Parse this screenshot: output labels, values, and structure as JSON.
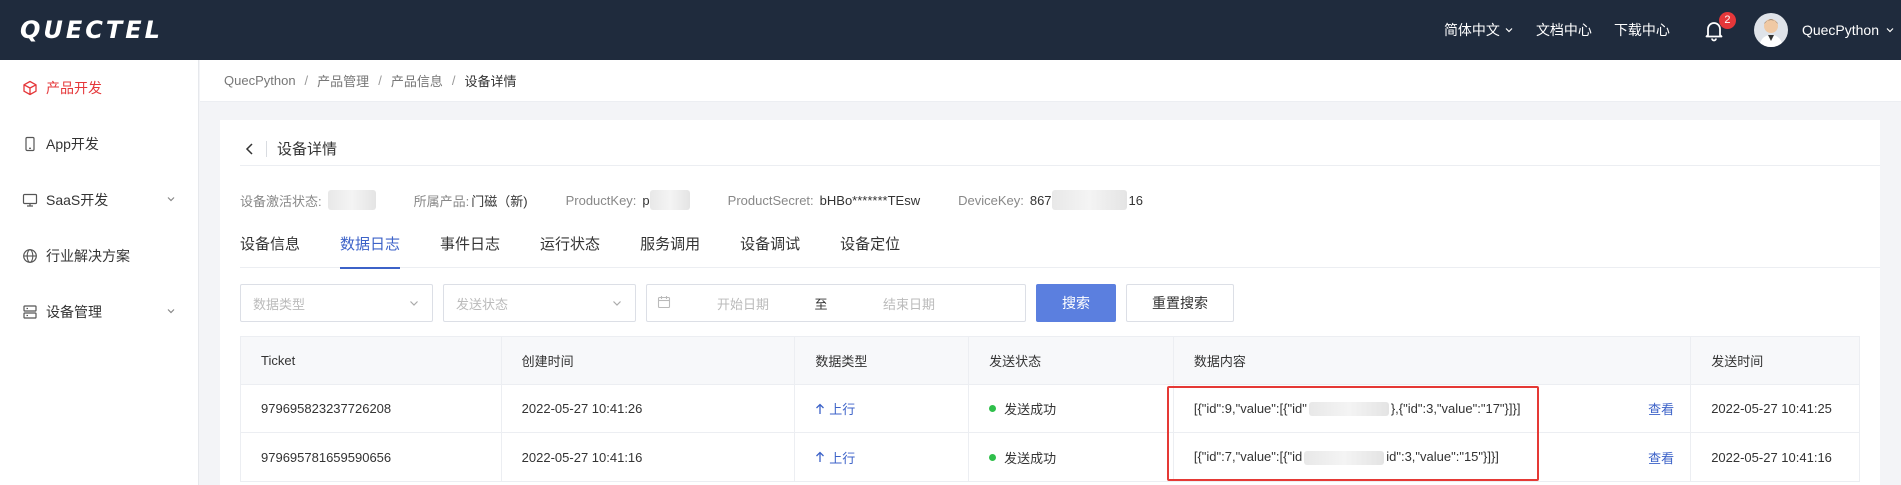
{
  "header": {
    "logo": "QUECTEL",
    "lang_label": "简体中文",
    "docs_label": "文档中心",
    "download_label": "下载中心",
    "notif_count": "2",
    "user_name": "QuecPython"
  },
  "sidebar": {
    "items": [
      {
        "label": "产品开发",
        "active": true
      },
      {
        "label": "App开发"
      },
      {
        "label": "SaaS开发"
      },
      {
        "label": "行业解决方案"
      },
      {
        "label": "设备管理"
      }
    ]
  },
  "breadcrumb": [
    "QuecPython",
    "产品管理",
    "产品信息",
    "设备详情"
  ],
  "card": {
    "title": "设备详情",
    "info": {
      "status_label": "设备激活状态:",
      "product_label": "所属产品:",
      "product_value": "门磁（新)",
      "productkey_label": "ProductKey:",
      "productkey_value": "p",
      "productsecret_label": "ProductSecret:",
      "productsecret_value": "bHBo*******TEsw",
      "devicekey_label": "DeviceKey:",
      "devicekey_prefix": "867",
      "devicekey_suffix": "16"
    },
    "tabs": [
      "设备信息",
      "数据日志",
      "事件日志",
      "运行状态",
      "服务调用",
      "设备调试",
      "设备定位"
    ],
    "active_tab": "数据日志",
    "filters": {
      "data_type_placeholder": "数据类型",
      "send_status_placeholder": "发送状态",
      "start_date_placeholder": "开始日期",
      "to_label": "至",
      "end_date_placeholder": "结束日期",
      "search_button": "搜索",
      "reset_button": "重置搜索"
    },
    "table": {
      "columns": [
        "Ticket",
        "创建时间",
        "数据类型",
        "发送状态",
        "数据内容",
        "发送时间"
      ],
      "rows": [
        {
          "ticket": "979695823237726208",
          "created": "2022-05-27 10:41:26",
          "type": "上行",
          "status": "发送成功",
          "content_start": "[{\"id\":9,\"value\":[{\"id\"",
          "content_end": "},{\"id\":3,\"value\":\"17\"}]}]",
          "view": "查看",
          "sent": "2022-05-27 10:41:25"
        },
        {
          "ticket": "979695781659590656",
          "created": "2022-05-27 10:41:16",
          "type": "上行",
          "status": "发送成功",
          "content_start": "[{\"id\":7,\"value\":[{\"id",
          "content_end": "id\":3,\"value\":\"15\"}]}]",
          "view": "查看",
          "sent": "2022-05-27 10:41:16"
        }
      ]
    }
  },
  "colors": {
    "topbar_bg": "#1f2b3d",
    "accent_red": "#e5373a",
    "primary_blue": "#5b7fdf",
    "link_blue": "#3c62c8",
    "success_green": "#2fbf4b",
    "highlight_box": "#e53935"
  }
}
